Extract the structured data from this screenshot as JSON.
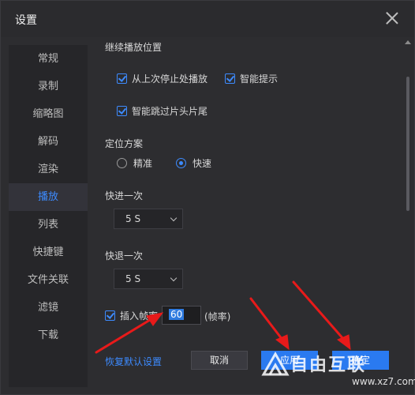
{
  "window": {
    "title": "设置"
  },
  "sidebar": {
    "items": [
      {
        "label": "常规",
        "active": false
      },
      {
        "label": "录制",
        "active": false
      },
      {
        "label": "缩略图",
        "active": false
      },
      {
        "label": "解码",
        "active": false
      },
      {
        "label": "渲染",
        "active": false
      },
      {
        "label": "播放",
        "active": true
      },
      {
        "label": "列表",
        "active": false
      },
      {
        "label": "快捷键",
        "active": false
      },
      {
        "label": "文件关联",
        "active": false
      },
      {
        "label": "滤镜",
        "active": false
      },
      {
        "label": "下载",
        "active": false
      }
    ]
  },
  "playback": {
    "resume_section": "继续播放位置",
    "resume_from_last": {
      "label": "从上次停止处播放",
      "checked": true
    },
    "smart_hint": {
      "label": "智能提示",
      "checked": true
    },
    "skip_intro_outro": {
      "label": "智能跳过片头片尾",
      "checked": true
    },
    "seek_section": "定位方案",
    "seek_options": [
      {
        "label": "精准",
        "selected": false
      },
      {
        "label": "快速",
        "selected": true
      }
    ],
    "forward_section": "快进一次",
    "forward_value": "5 S",
    "backward_section": "快退一次",
    "backward_value": "5 S",
    "insert_frames": {
      "label": "插入帧率",
      "checked": true,
      "value": "60",
      "unit": "(帧率)"
    }
  },
  "footer": {
    "restore_defaults": "恢复默认设置",
    "cancel": "取消",
    "apply": "应用",
    "ok": "确定"
  },
  "watermark": {
    "brand": "自由互联",
    "url": "www.xz7.com"
  },
  "colors": {
    "accent": "#3d8bff",
    "button_primary": "#2a7af0",
    "arrow": "#e81a1a"
  }
}
